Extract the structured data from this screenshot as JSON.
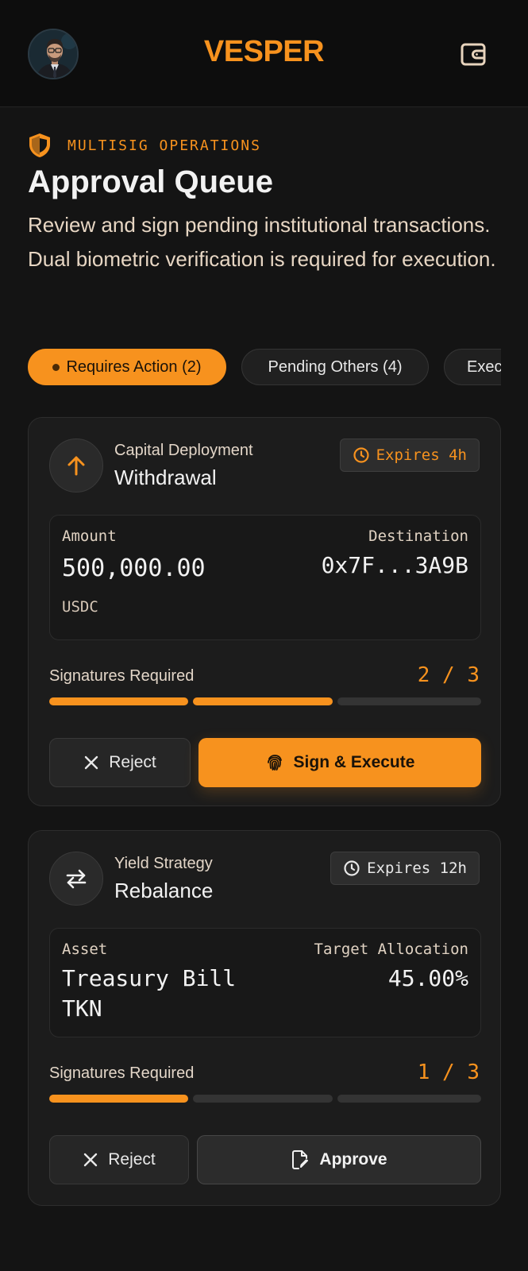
{
  "header": {
    "brand": "VESPER",
    "avatar_icon": "user-avatar-icon",
    "wallet_icon": "wallet-icon"
  },
  "hero": {
    "eyebrow": "MULTISIG OPERATIONS",
    "eyebrow_icon": "shield-icon",
    "title": "Approval Queue",
    "description": "Review and sign pending institutional transactions. Dual biometric verification is required for execution."
  },
  "tabs": [
    {
      "label": "Requires Action (2)",
      "active": true
    },
    {
      "label": "Pending Others (4)",
      "active": false
    },
    {
      "label": "Exec",
      "active": false
    }
  ],
  "cards": [
    {
      "icon": "arrow-up-icon",
      "subtitle": "Capital Deployment",
      "title": "Withdrawal",
      "expires": "Expires 4h",
      "left_label": "Amount",
      "left_value": "500,000.00",
      "left_unit": "USDC",
      "right_label": "Destination",
      "right_value": "0x7F...3A9B",
      "signatures_label": "Signatures Required",
      "signatures_count": "2 / 3",
      "signatures_collected": 2,
      "signatures_total": 3,
      "reject_label": "Reject",
      "action_label": "Sign & Execute",
      "action_icon": "fingerprint-icon"
    },
    {
      "icon": "swap-arrows-icon",
      "subtitle": "Yield Strategy",
      "title": "Rebalance",
      "expires": "Expires 12h",
      "left_label": "Asset",
      "left_value_line1": "Treasury Bill",
      "left_value_line2": "TKN",
      "right_label": "Target Allocation",
      "right_value": "45.00%",
      "signatures_label": "Signatures Required",
      "signatures_count": "1 / 3",
      "signatures_collected": 1,
      "signatures_total": 3,
      "reject_label": "Reject",
      "action_label": "Approve",
      "action_icon": "document-sign-icon"
    }
  ],
  "colors": {
    "accent": "#f7921e",
    "background": "#141414",
    "card": "#1c1c1c"
  }
}
